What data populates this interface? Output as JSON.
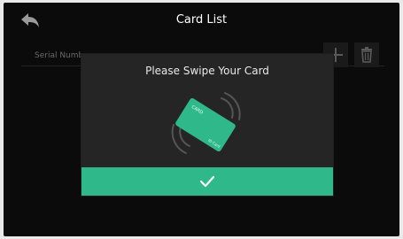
{
  "header": {
    "title": "Card List",
    "back_icon": "back-arrow-icon"
  },
  "list": {
    "serial_header": "Serial Numb",
    "add_icon": "plus-icon",
    "delete_icon": "trash-icon"
  },
  "dialog": {
    "title": "Please Swipe Your Card",
    "card_text_top": "CARD",
    "card_text_bottom": "ID Card",
    "confirm_icon": "checkmark-icon",
    "accent_color": "#2fb98a"
  }
}
